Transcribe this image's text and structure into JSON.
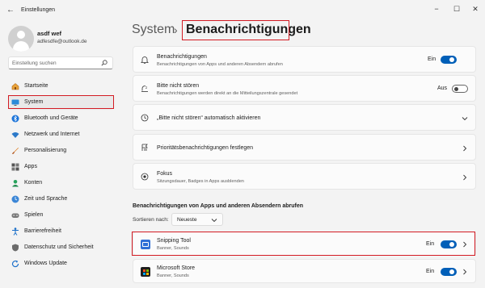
{
  "window": {
    "title": "Einstellungen",
    "back_glyph": "←",
    "minimize_glyph": "−",
    "maximize_glyph": "☐",
    "close_glyph": "✕"
  },
  "user": {
    "name": "asdf wef",
    "email": "adfesdfe@outlook.de"
  },
  "search": {
    "placeholder": "Einstellung suchen"
  },
  "sidebar": {
    "items": [
      {
        "label": "Startseite",
        "icon": "home-icon"
      },
      {
        "label": "System",
        "icon": "monitor-icon"
      },
      {
        "label": "Bluetooth und Geräte",
        "icon": "bluetooth-icon"
      },
      {
        "label": "Netzwerk und Internet",
        "icon": "wifi-icon"
      },
      {
        "label": "Personalisierung",
        "icon": "brush-icon"
      },
      {
        "label": "Apps",
        "icon": "apps-icon"
      },
      {
        "label": "Konten",
        "icon": "account-icon"
      },
      {
        "label": "Zeit und Sprache",
        "icon": "globe-clock-icon"
      },
      {
        "label": "Spielen",
        "icon": "gamepad-icon"
      },
      {
        "label": "Barrierefreiheit",
        "icon": "accessibility-icon"
      },
      {
        "label": "Datenschutz und Sicherheit",
        "icon": "shield-icon"
      },
      {
        "label": "Windows Update",
        "icon": "update-icon"
      }
    ]
  },
  "breadcrumb": {
    "parent": "System",
    "separator": "›",
    "current": "Benachrichtigungen"
  },
  "settings": [
    {
      "title": "Benachrichtigungen",
      "subtitle": "Benachrichtigungen von Apps und anderen Absendern abrufen",
      "state": "Ein",
      "toggle": true,
      "icon": "bell-icon"
    },
    {
      "title": "Bitte nicht stören",
      "subtitle": "Benachrichtigungen werden direkt an die Mitteilungszentrale gesendet",
      "state": "Aus",
      "toggle": false,
      "icon": "do-not-disturb-icon"
    },
    {
      "title": "„Bitte nicht stören“ automatisch aktivieren",
      "icon": "clock-icon"
    },
    {
      "title": "Prioritätsbenachrichtigungen festlegen",
      "icon": "priority-icon"
    },
    {
      "title": "Fokus",
      "subtitle": "Sitzungsdauer, Badges in Apps ausblenden",
      "icon": "focus-icon"
    }
  ],
  "apps_section": {
    "title": "Benachrichtigungen von Apps und anderen Absendern abrufen",
    "sort_label": "Sortieren nach:",
    "sort_value": "Neueste",
    "apps": [
      {
        "name": "Snipping Tool",
        "subtitle": "Banner, Sounds",
        "state": "Ein",
        "toggle": true,
        "icon": "snipping-tool-icon"
      },
      {
        "name": "Microsoft Store",
        "subtitle": "Banner, Sounds",
        "state": "Ein",
        "toggle": true,
        "icon": "microsoft-store-icon"
      }
    ]
  },
  "colors": {
    "accent": "#005fb8",
    "highlight": "#d31b23",
    "background": "#f3f3f3",
    "card": "#fbfbfb"
  }
}
